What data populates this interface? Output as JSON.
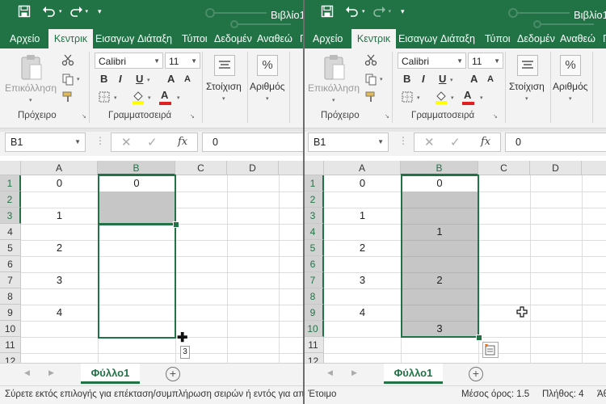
{
  "app": {
    "book_title": "Βιβλίο1"
  },
  "colors": {
    "accent": "#217346",
    "selection_fill": "#c6c6c6"
  },
  "tabs": [
    "Αρχείο",
    "Κεντρικ",
    "Εισαγωγ",
    "Διάταξη",
    "Τύποι",
    "Δεδομέν",
    "Αναθεώ",
    "Π"
  ],
  "ribbon": {
    "clipboard": {
      "paste_label": "Επικόλληση",
      "group_label": "Πρόχειρο"
    },
    "font": {
      "name": "Calibri",
      "size": "11",
      "bold": "B",
      "italic": "I",
      "underline": "U",
      "grow": "A",
      "shrink": "A",
      "font_color_glyph": "A",
      "group_label": "Γραμματοσειρά"
    },
    "alignment_label": "Στοίχιση",
    "number_label": "Αριθμός",
    "number_icon": "%"
  },
  "formula_bar": {
    "name_box": "B1",
    "fx_label": "fx",
    "value": "0"
  },
  "columns": [
    "A",
    "B",
    "C",
    "D"
  ],
  "rows": [
    "1",
    "2",
    "3",
    "4",
    "5",
    "6",
    "7",
    "8",
    "9",
    "10",
    "11",
    "12"
  ],
  "left_cells": {
    "A1": "0",
    "B1": "0",
    "A3": "1",
    "A5": "2",
    "A7": "3",
    "A9": "4"
  },
  "right_cells": {
    "A1": "0",
    "B1": "0",
    "A3": "1",
    "B4": "1",
    "A5": "2",
    "B7": "2",
    "A7": "3",
    "B10": "3",
    "A9": "4"
  },
  "fill_tooltip": "3",
  "sheet_tab": "Φύλλο1",
  "add_sheet": "+",
  "status": {
    "left_message": "Σύρετε εκτός επιλογής για επέκταση/συμπλήρωση σειρών ή εντός για απαλοιφή",
    "right_ready": "Έτοιμο",
    "average": "Μέσος όρος: 1.5",
    "count": "Πλήθος: 4",
    "sum_partial": "Άθ"
  }
}
